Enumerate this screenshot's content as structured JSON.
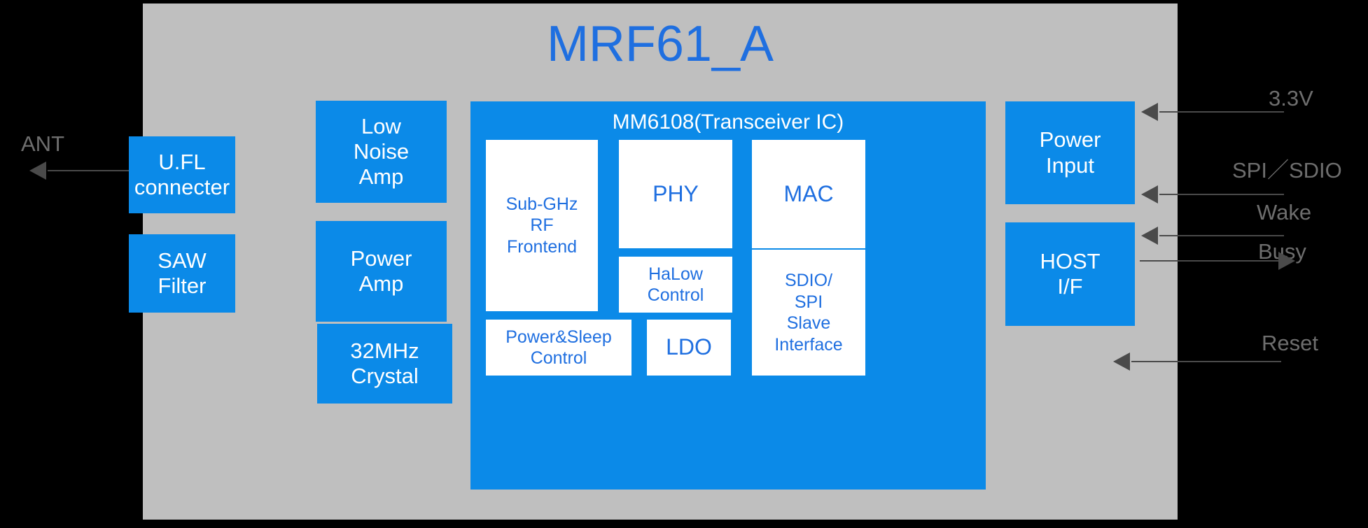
{
  "module": {
    "title": "MRF61_A",
    "title_color": "#1f6fe0",
    "panel_color": "#bfbfbf",
    "block_color": "#0b8ae8"
  },
  "left_blocks": [
    {
      "id": "ufl-connector",
      "label": "U.FL\nconnecter"
    },
    {
      "id": "saw-filter",
      "label": "SAW\nFilter"
    }
  ],
  "rf_blocks": [
    {
      "id": "low-noise-amp",
      "label": "Low\nNoise\nAmp"
    },
    {
      "id": "power-amp",
      "label": "Power\nAmp"
    },
    {
      "id": "crystal",
      "label": "32MHz\nCrystal"
    }
  ],
  "transceiver": {
    "title": "MM6108(Transceiver IC)",
    "blocks": [
      {
        "id": "sub-ghz-rf-frontend",
        "label": "Sub-GHz\nRF\nFrontend"
      },
      {
        "id": "phy",
        "label": "PHY"
      },
      {
        "id": "mac",
        "label": "MAC"
      },
      {
        "id": "halow-control",
        "label": "HaLow\nControl"
      },
      {
        "id": "sdio-spi-slave",
        "label": "SDIO/\nSPI\nSlave\nInterface"
      },
      {
        "id": "power-sleep-control",
        "label": "Power&Sleep\nControl"
      },
      {
        "id": "ldo",
        "label": "LDO"
      }
    ]
  },
  "right_blocks": [
    {
      "id": "power-input",
      "label": "Power\nInput"
    },
    {
      "id": "host-if",
      "label": "HOST\nI/F"
    }
  ],
  "signals": {
    "antenna": {
      "label": "ANT",
      "direction": "out"
    },
    "right": [
      {
        "id": "supply-3v3",
        "label": "3.3V",
        "direction": "in"
      },
      {
        "id": "spi-sdio",
        "label": "SPI／SDIO",
        "direction": "in"
      },
      {
        "id": "wake",
        "label": "Wake",
        "direction": "in"
      },
      {
        "id": "busy",
        "label": "Busy",
        "direction": "out"
      },
      {
        "id": "reset",
        "label": "Reset",
        "direction": "in"
      }
    ]
  }
}
